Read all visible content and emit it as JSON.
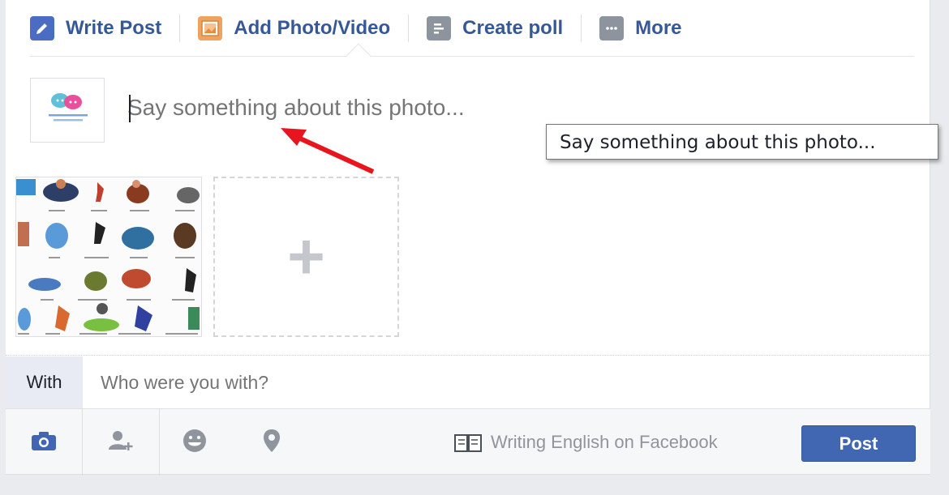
{
  "tabs": [
    {
      "label": "Write Post",
      "icon": "pencil-icon"
    },
    {
      "label": "Add Photo/Video",
      "icon": "photo-icon"
    },
    {
      "label": "Create poll",
      "icon": "poll-icon"
    },
    {
      "label": "More",
      "icon": "more-icon"
    }
  ],
  "composer": {
    "placeholder": "Say something about this photo...",
    "tooltip": "Say something about this photo..."
  },
  "with": {
    "label": "With",
    "placeholder": "Who were you with?"
  },
  "footer": {
    "icons": [
      "camera-icon",
      "tag-friends-icon",
      "feeling-icon",
      "location-icon"
    ],
    "writing_link": "Writing English on Facebook",
    "post_label": "Post"
  },
  "colors": {
    "accent": "#4267b2",
    "link": "#365899",
    "annotation_arrow": "#e8141e"
  }
}
